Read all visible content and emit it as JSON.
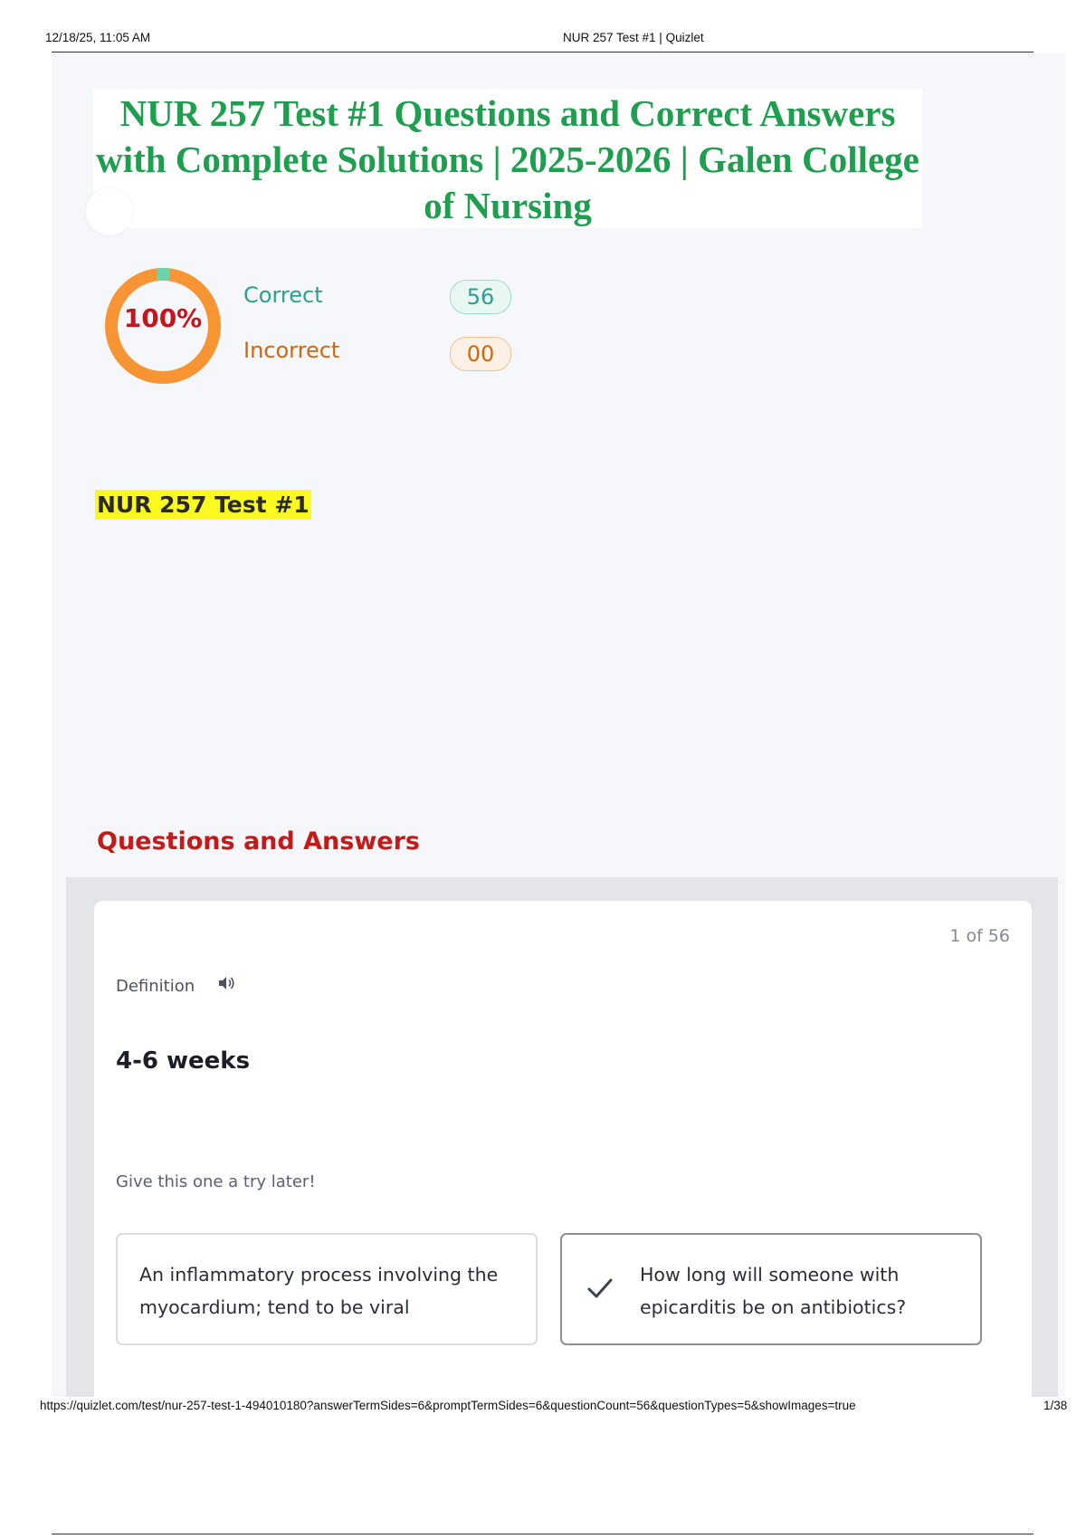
{
  "print_header": {
    "datetime": "12/18/25, 11:05 AM",
    "page_title": "NUR 257 Test #1 | Quizlet"
  },
  "document": {
    "title": "NUR 257 Test #1 Questions and Correct Answers with Complete Solutions | 2025-2026 | Galen College of Nursing"
  },
  "score": {
    "percent_label": "100%",
    "percent_value": 100,
    "correct_label": "Correct",
    "correct_count": "56",
    "incorrect_label": "Incorrect",
    "incorrect_count": "00",
    "colors": {
      "ring": "#f79433",
      "ring_marker": "#6bd3a8",
      "percent_text": "#c4151c",
      "correct": "#2e9e8e",
      "incorrect": "#d0660f"
    }
  },
  "set_title": "NUR 257 Test #1",
  "section_heading": "Questions and Answers",
  "question_card": {
    "progress": "1 of 56",
    "definition_label": "Definition",
    "audio_icon": "speaker-icon",
    "term": "4-6 weeks",
    "hint": "Give this one a try later!",
    "options": [
      {
        "text": "An inflammatory process involving the myocardium; tend to be viral",
        "selected": false
      },
      {
        "text": "How long will someone with epicarditis be on antibiotics?",
        "selected": true,
        "icon": "check-icon"
      }
    ]
  },
  "print_footer": {
    "url": "https://quizlet.com/test/nur-257-test-1-494010180?answerTermSides=6&promptTermSides=6&questionCount=56&questionTypes=5&showImages=true",
    "page": "1/38"
  }
}
